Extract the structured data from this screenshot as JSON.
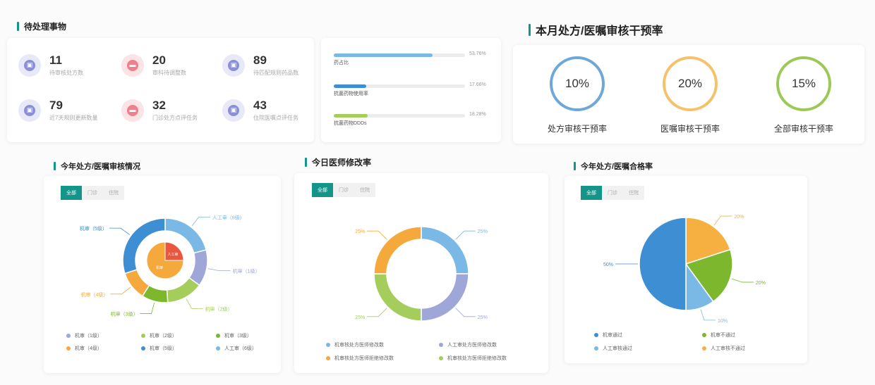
{
  "pending": {
    "title": "待处理事物",
    "items": [
      {
        "value": "11",
        "label": "待审核处方数",
        "icon": "lock-icon"
      },
      {
        "value": "20",
        "label": "审科待调整数",
        "icon": "message-icon"
      },
      {
        "value": "89",
        "label": "待匹配规则药品数",
        "icon": "lock-icon"
      },
      {
        "value": "79",
        "label": "近7天规则更新数量",
        "icon": "lock-icon"
      },
      {
        "value": "32",
        "label": "门诊处方点评任务",
        "icon": "message-icon"
      },
      {
        "value": "43",
        "label": "住院医嘱点评任务",
        "icon": "lock-icon"
      }
    ]
  },
  "ratios": [
    {
      "label": "药占比",
      "pct_text": "53.76%",
      "value": 0.5376,
      "color": "#7ab8e6"
    },
    {
      "label": "抗菌药物使用率",
      "pct_text": "17.66%",
      "value": 0.1766,
      "color": "#3d8ed3"
    },
    {
      "label": "抗菌药物DDDs",
      "pct_text": "18.28%",
      "value": 0.1828,
      "color": "#a5cd5c"
    }
  ],
  "intervention": {
    "title": "本月处方/医嘱审核干预率",
    "rings": [
      {
        "value": "10%",
        "label": "处方审核干预率",
        "color": "#6ea8da"
      },
      {
        "value": "20%",
        "label": "医嘱审核干预率",
        "color": "#f5c26b"
      },
      {
        "value": "15%",
        "label": "全部审核干预率",
        "color": "#9cc955"
      }
    ]
  },
  "tabs": {
    "all": "全部",
    "outpatient": "门诊",
    "inpatient": "住院"
  },
  "colors": {
    "accent": "#14958a"
  },
  "chart_data": [
    {
      "type": "pie",
      "title": "今年处方/医嘱审核情况",
      "inner": [
        {
          "name": "人工审",
          "value": 25,
          "color": "#e8573e"
        },
        {
          "name": "机审",
          "value": 75,
          "color": "#f5a93c"
        }
      ],
      "outer": [
        {
          "name": "人工审（6级）",
          "value": 21,
          "color": "#7ab8e6"
        },
        {
          "name": "机审（1级）",
          "value": 14,
          "color": "#9fa6d8"
        },
        {
          "name": "机审（2级）",
          "value": 14,
          "color": "#a5cd5c"
        },
        {
          "name": "机审（3级）",
          "value": 10,
          "color": "#7cb72e"
        },
        {
          "name": "机审（4级）",
          "value": 11,
          "color": "#f5a93c"
        },
        {
          "name": "机审（5级）",
          "value": 30,
          "color": "#3d8ed3"
        }
      ],
      "legend": [
        {
          "name": "机审（1级）",
          "color": "#9fa6d8"
        },
        {
          "name": "机审（2级）",
          "color": "#a5cd5c"
        },
        {
          "name": "机审（3级）",
          "color": "#7cb72e"
        },
        {
          "name": "机审（4级）",
          "color": "#f5a93c"
        },
        {
          "name": "机审（5级）",
          "color": "#3d8ed3"
        },
        {
          "name": "人工审（6级）",
          "color": "#7ab8e6"
        }
      ]
    },
    {
      "type": "pie",
      "title": "今日医师修改率",
      "slices": [
        {
          "name": "机审核处方医师修改数",
          "value": 25,
          "label": "25%",
          "color": "#7ab8e6"
        },
        {
          "name": "人工审处方医师修改数",
          "value": 25,
          "label": "25%",
          "color": "#9fa6d8"
        },
        {
          "name": "机审核处方医师拒绝修改数",
          "value": 25,
          "label": "25%",
          "color": "#a5cd5c"
        },
        {
          "name": "机审核处方医师拒绝修改数",
          "value": 25,
          "label": "25%",
          "color": "#f5a93c"
        }
      ],
      "legend": [
        {
          "name": "机审核处方医师修改数",
          "color": "#7ab8e6"
        },
        {
          "name": "人工审处方医师修改数",
          "color": "#9fa6d8"
        },
        {
          "name": "机审核处方医师拒绝修改数",
          "color": "#f5a93c"
        },
        {
          "name": "机审核处方医师拒绝修改数",
          "color": "#a5cd5c"
        }
      ]
    },
    {
      "type": "pie",
      "title": "今年处方/医嘱合格率",
      "slices": [
        {
          "name": "人工审核不通过",
          "value": 20,
          "label": "20%",
          "color": "#f5b041"
        },
        {
          "name": "机审不通过",
          "value": 20,
          "label": "20%",
          "color": "#7cb72e"
        },
        {
          "name": "人工审核通过",
          "value": 10,
          "label": "10%",
          "color": "#7ab8e6"
        },
        {
          "name": "机审通过",
          "value": 50,
          "label": "50%",
          "color": "#3d8ed3"
        }
      ],
      "legend": [
        {
          "name": "机审通过",
          "color": "#3d8ed3"
        },
        {
          "name": "机审不通过",
          "color": "#7cb72e"
        },
        {
          "name": "人工审核通过",
          "color": "#7ab8e6"
        },
        {
          "name": "人工审核不通过",
          "color": "#f5b041"
        }
      ]
    }
  ]
}
